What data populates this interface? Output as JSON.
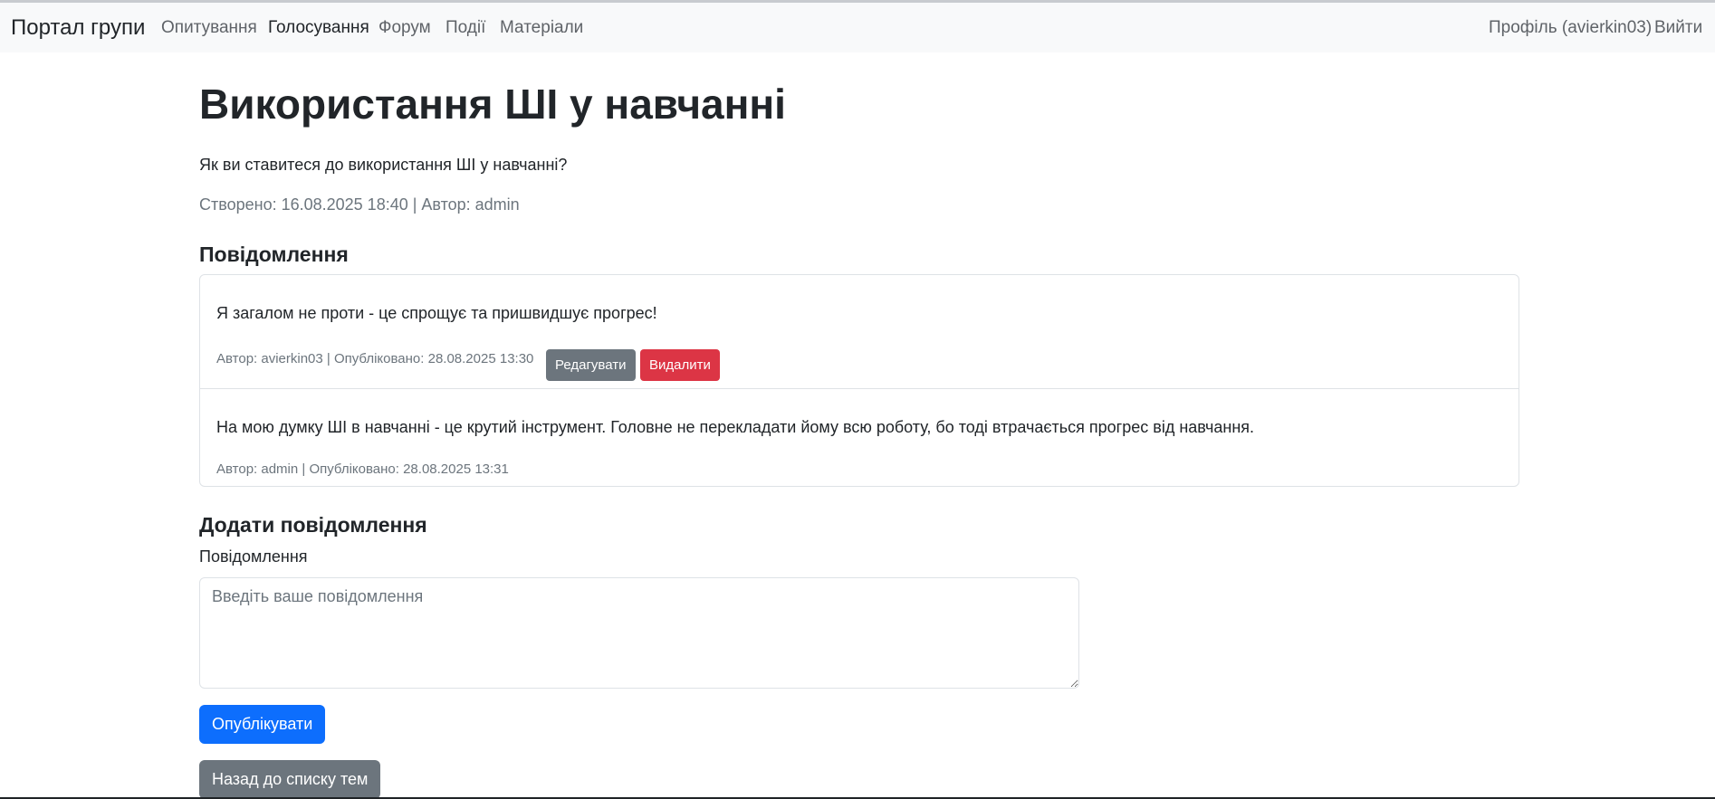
{
  "navbar": {
    "brand": "Портал групи",
    "links": [
      {
        "label": "Опитування"
      },
      {
        "label": "Голосування"
      },
      {
        "label": "Форум"
      },
      {
        "label": "Події"
      },
      {
        "label": "Матеріали"
      }
    ],
    "profile": "Профіль (avierkin03)",
    "logout": "Вийти"
  },
  "topic": {
    "title": "Використання ШІ у навчанні",
    "question": "Як ви ставитеся до використання ШІ у навчанні?",
    "meta": "Створено: 16.08.2025 18:40 | Автор: admin"
  },
  "messages_section": {
    "title": "Повідомлення",
    "items": [
      {
        "text": "Я загалом не проти - це спрощує та пришвидшує прогрес!",
        "meta": "Автор: avierkin03 | Опубліковано: 28.08.2025 13:30",
        "edit_label": "Редагувати",
        "delete_label": "Видалити"
      },
      {
        "text": "На мою думку ШІ в навчанні - це крутий інструмент. Головне не перекладати йому всю роботу, бо тоді втрачається прогрес від навчання.",
        "meta": "Автор: admin | Опубліковано: 28.08.2025 13:31"
      }
    ]
  },
  "add_form": {
    "title": "Додати повідомлення",
    "field_label": "Повідомлення",
    "placeholder": "Введіть ваше повідомлення",
    "value": "",
    "submit_label": "Опублікувати",
    "back_label": "Назад до списку тем"
  },
  "colors": {
    "primary": "#0d6efd",
    "secondary": "#6c757d",
    "danger": "#dc3545",
    "navbar_bg": "#f8f9fa"
  }
}
